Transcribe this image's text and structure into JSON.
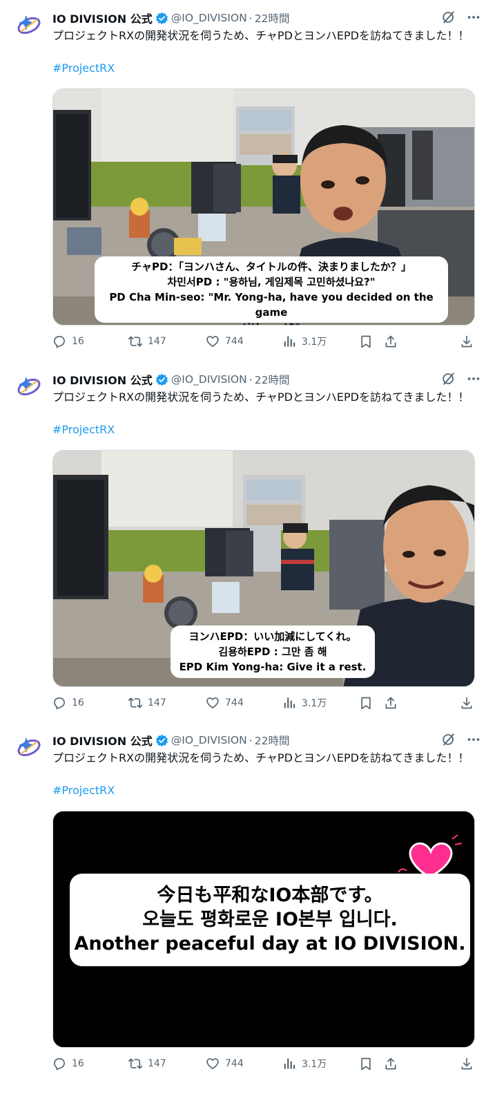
{
  "tweets": [
    {
      "name": "IO DIVISION 公式",
      "handle": "@IO_DIVISION",
      "dot": "·",
      "time": "22時間",
      "text": "プロジェクトRXの開発状況を伺うため、チャPDとヨンハEPDを訪ねてきました！！",
      "hashtag": "#ProjectRX",
      "caption": [
        "チャPD：「ヨンハさん、タイトルの件、決まりましたか？」",
        "차민서PD : \"용하님, 게임제목 고민하셨나요?\"",
        "PD Cha Min-seo: \"Mr. Yong-ha, have you decided on the game",
        "title yet?\""
      ],
      "replies": "16",
      "retweets": "147",
      "likes": "744",
      "views": "3.1万"
    },
    {
      "name": "IO DIVISION 公式",
      "handle": "@IO_DIVISION",
      "dot": "·",
      "time": "22時間",
      "text": "プロジェクトRXの開発状況を伺うため、チャPDとヨンハEPDを訪ねてきました！！",
      "hashtag": "#ProjectRX",
      "caption": [
        "ヨンハEPD：いい加減にしてくれ。",
        "김용하EPD : 그만 좀 해",
        "EPD Kim Yong-ha: Give it a rest."
      ],
      "replies": "16",
      "retweets": "147",
      "likes": "744",
      "views": "3.1万"
    },
    {
      "name": "IO DIVISION 公式",
      "handle": "@IO_DIVISION",
      "dot": "·",
      "time": "22時間",
      "text": "プロジェクトRXの開発状況を伺うため、チャPDとヨンハEPDを訪ねてきました！！",
      "hashtag": "#ProjectRX",
      "caption": [
        "今日も平和なIO本部です。",
        "오늘도 평화로운 IO본부 입니다.",
        "Another peaceful day at IO DIVISION."
      ],
      "replies": "16",
      "retweets": "147",
      "likes": "744",
      "views": "3.1万"
    }
  ],
  "colors": {
    "accent": "#1d9bf0",
    "muted": "#536471",
    "text": "#0f1419",
    "verified": "#1d9bf0"
  },
  "icons": [
    "io-division-logo",
    "verified-badge-icon",
    "grok-icon",
    "more-icon",
    "reply-icon",
    "retweet-icon",
    "like-icon",
    "views-icon",
    "bookmark-icon",
    "share-icon",
    "download-icon"
  ]
}
